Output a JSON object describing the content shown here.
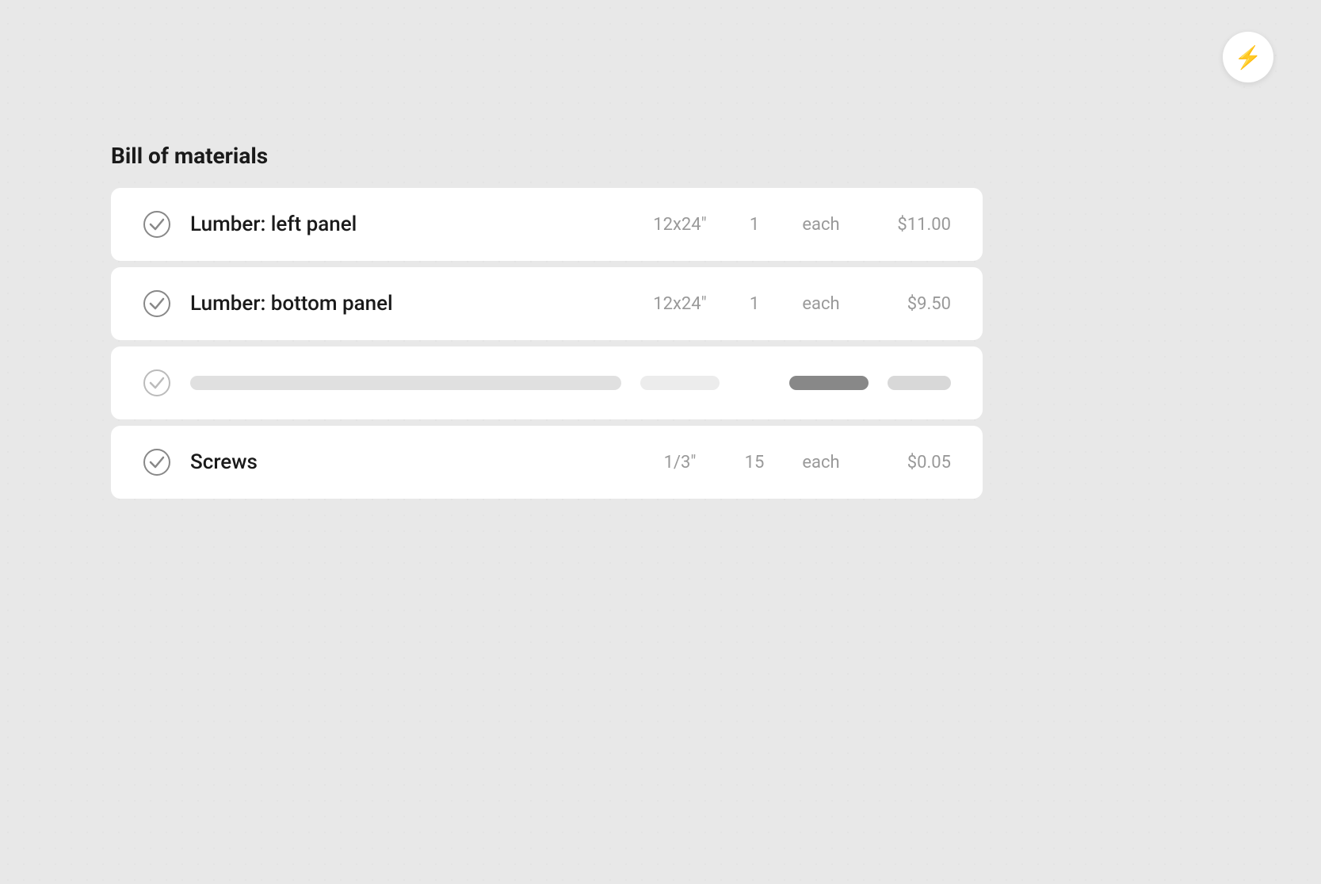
{
  "app": {
    "icon": "⚡",
    "icon_color": "#F5A623"
  },
  "page": {
    "title": "Bill of materials"
  },
  "items": [
    {
      "id": "item-1",
      "name": "Lumber: left panel",
      "size": "12x24\"",
      "qty": "1",
      "unit": "each",
      "price": "$11.00",
      "checked": true,
      "loading": false
    },
    {
      "id": "item-2",
      "name": "Lumber: bottom panel",
      "size": "12x24\"",
      "qty": "1",
      "unit": "each",
      "price": "$9.50",
      "checked": true,
      "loading": false
    },
    {
      "id": "item-3",
      "name": "",
      "size": "",
      "qty": "",
      "unit": "",
      "price": "",
      "checked": true,
      "loading": true
    },
    {
      "id": "item-4",
      "name": "Screws",
      "size": "1/3\"",
      "qty": "15",
      "unit": "each",
      "price": "$0.05",
      "checked": true,
      "loading": false
    }
  ],
  "labels": {
    "title": "Bill of materials"
  }
}
